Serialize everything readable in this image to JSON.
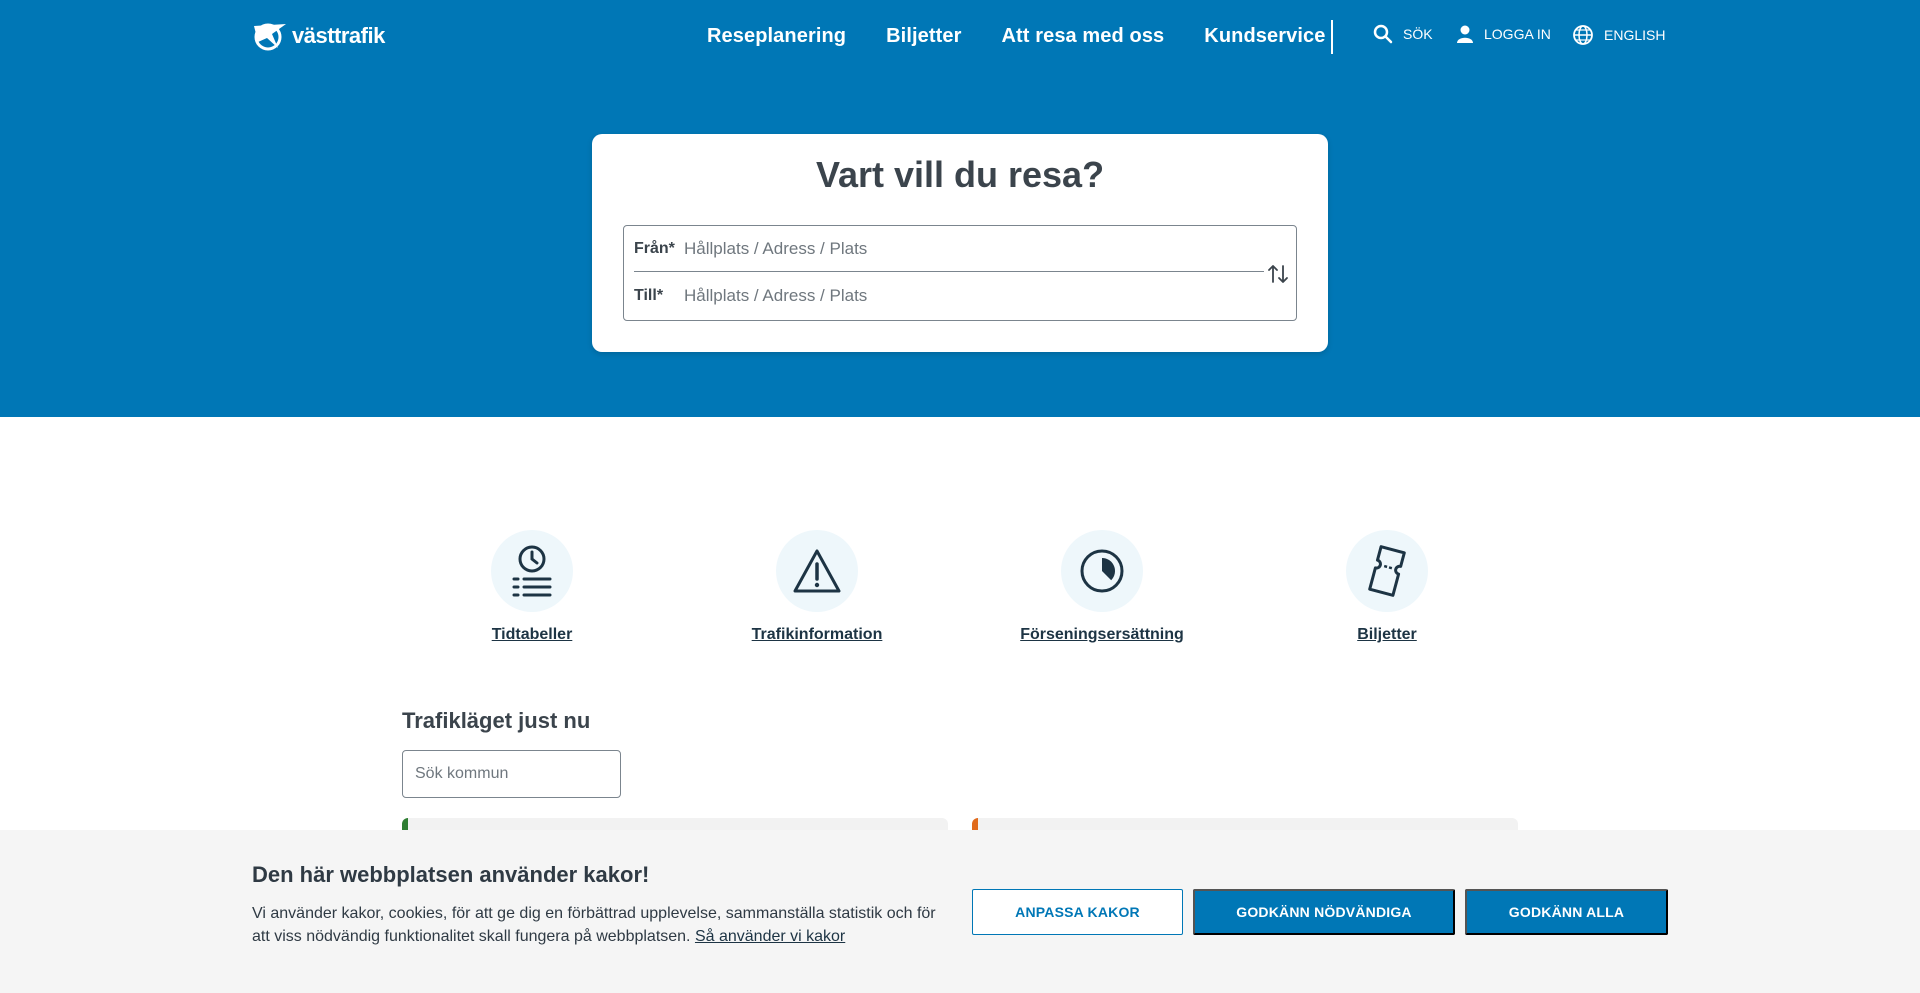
{
  "header": {
    "logo_text": "västtrafik",
    "nav": [
      "Reseplanering",
      "Biljetter",
      "Att resa med oss",
      "Kundservice"
    ],
    "search_label": "SÖK",
    "login_label": "LOGGA IN",
    "language_label": "ENGLISH"
  },
  "planner": {
    "title": "Vart vill du resa?",
    "from_label": "Från*",
    "from_placeholder": "Hållplats / Adress / Plats",
    "to_label": "Till*",
    "to_placeholder": "Hållplats / Adress / Plats"
  },
  "quicklinks": [
    {
      "label": "Tidtabeller",
      "icon": "timetable-icon"
    },
    {
      "label": "Trafikinformation",
      "icon": "warning-icon"
    },
    {
      "label": "Förseningsersättning",
      "icon": "clock-pie-icon"
    },
    {
      "label": "Biljetter",
      "icon": "ticket-icon"
    }
  ],
  "traffic": {
    "title": "Trafikläget just nu",
    "search_placeholder": "Sök kommun"
  },
  "cookie": {
    "title": "Den här webbplatsen använder kakor!",
    "text": "Vi använder kakor, cookies, för att ge dig en förbättrad upplevelse, sammanställa statistik och för att viss nödvändig funktionalitet skall fungera på webbplatsen.",
    "link": "Så använder vi kakor",
    "btn_customize": "ANPASSA KAKOR",
    "btn_necessary": "GODKÄNN NÖDVÄNDIGA",
    "btn_all": "GODKÄNN ALLA"
  },
  "colors": {
    "brand_blue": "#0077b6",
    "status_green": "#2e7d32",
    "status_orange": "#e06a1b"
  }
}
